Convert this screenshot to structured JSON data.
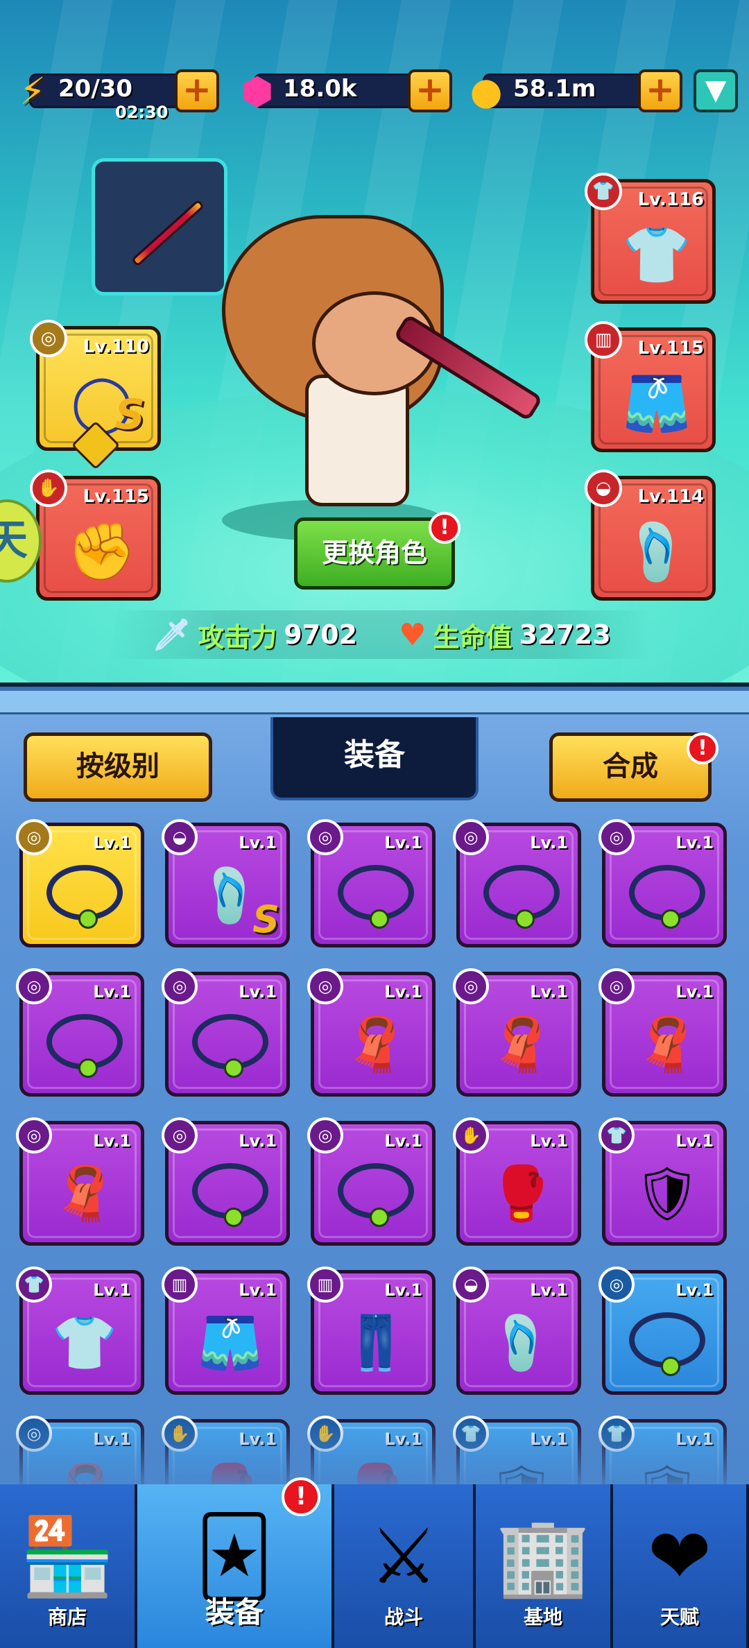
{
  "resources": {
    "energy": {
      "value": "20/30",
      "timer": "02:30",
      "icon": "lightning-icon"
    },
    "gems": {
      "value": "18.0k",
      "icon": "gem-icon"
    },
    "coins": {
      "value": "58.1m",
      "icon": "coin-icon"
    },
    "plus_label": "+"
  },
  "hero": {
    "slots": {
      "top_right": {
        "level": "Lv.116",
        "icon": "shirt-icon"
      },
      "mid_right": {
        "level": "Lv.115",
        "icon": "shorts-icon"
      },
      "bottom_right": {
        "level": "Lv.114",
        "icon": "shoe-icon"
      },
      "mid_left": {
        "level": "Lv.110",
        "icon": "necklace-icon",
        "grade": "S"
      },
      "bottom_left": {
        "level": "Lv.115",
        "icon": "glove-icon"
      }
    },
    "change_button": "更换角色",
    "alert": "!",
    "stats": {
      "attack_label": "攻击力",
      "attack_value": "9702",
      "hp_label": "生命值",
      "hp_value": "32723"
    }
  },
  "inventory": {
    "sort_button": "按级别",
    "title": "装备",
    "merge_button": "合成",
    "items": [
      {
        "level": "Lv.1",
        "rarity": "yellow",
        "icon": "necklace-icon",
        "grade": ""
      },
      {
        "level": "Lv.1",
        "rarity": "purple",
        "icon": "shoe-icon",
        "grade": "S"
      },
      {
        "level": "Lv.1",
        "rarity": "purple",
        "icon": "necklace-icon",
        "grade": ""
      },
      {
        "level": "Lv.1",
        "rarity": "purple",
        "icon": "necklace-icon",
        "grade": ""
      },
      {
        "level": "Lv.1",
        "rarity": "purple",
        "icon": "necklace-icon",
        "grade": ""
      },
      {
        "level": "Lv.1",
        "rarity": "purple",
        "icon": "necklace-icon",
        "grade": ""
      },
      {
        "level": "Lv.1",
        "rarity": "purple",
        "icon": "necklace-icon",
        "grade": ""
      },
      {
        "level": "Lv.1",
        "rarity": "purple",
        "icon": "scarf-icon",
        "grade": ""
      },
      {
        "level": "Lv.1",
        "rarity": "purple",
        "icon": "scarf-icon",
        "grade": ""
      },
      {
        "level": "Lv.1",
        "rarity": "purple",
        "icon": "scarf-icon",
        "grade": ""
      },
      {
        "level": "Lv.1",
        "rarity": "purple",
        "icon": "scarf-icon",
        "grade": ""
      },
      {
        "level": "Lv.1",
        "rarity": "purple",
        "icon": "necklace-icon",
        "grade": ""
      },
      {
        "level": "Lv.1",
        "rarity": "purple",
        "icon": "necklace-icon",
        "grade": ""
      },
      {
        "level": "Lv.1",
        "rarity": "purple",
        "icon": "glove-icon",
        "grade": ""
      },
      {
        "level": "Lv.1",
        "rarity": "purple",
        "icon": "armor-icon",
        "grade": ""
      },
      {
        "level": "Lv.1",
        "rarity": "purple",
        "icon": "shirt-icon",
        "grade": ""
      },
      {
        "level": "Lv.1",
        "rarity": "purple",
        "icon": "shorts-icon",
        "grade": ""
      },
      {
        "level": "Lv.1",
        "rarity": "purple",
        "icon": "pants-icon",
        "grade": ""
      },
      {
        "level": "Lv.1",
        "rarity": "purple",
        "icon": "shoe-icon",
        "grade": ""
      },
      {
        "level": "Lv.1",
        "rarity": "blue",
        "icon": "necklace-icon",
        "grade": ""
      },
      {
        "level": "Lv.1",
        "rarity": "blue",
        "icon": "scarf-icon",
        "grade": ""
      },
      {
        "level": "Lv.1",
        "rarity": "blue",
        "icon": "glove-icon",
        "grade": ""
      },
      {
        "level": "Lv.1",
        "rarity": "blue",
        "icon": "glove-icon",
        "grade": ""
      },
      {
        "level": "Lv.1",
        "rarity": "blue",
        "icon": "armor-icon",
        "grade": ""
      },
      {
        "level": "Lv.1",
        "rarity": "blue",
        "icon": "armor-icon",
        "grade": ""
      }
    ]
  },
  "nav": {
    "items": [
      {
        "label": "商店",
        "icon": "shop-icon"
      },
      {
        "label": "装备",
        "icon": "equipment-icon"
      },
      {
        "label": "战斗",
        "icon": "battle-icon"
      },
      {
        "label": "基地",
        "icon": "base-icon"
      },
      {
        "label": "天赋",
        "icon": "talent-icon"
      }
    ],
    "active_index": 1
  }
}
